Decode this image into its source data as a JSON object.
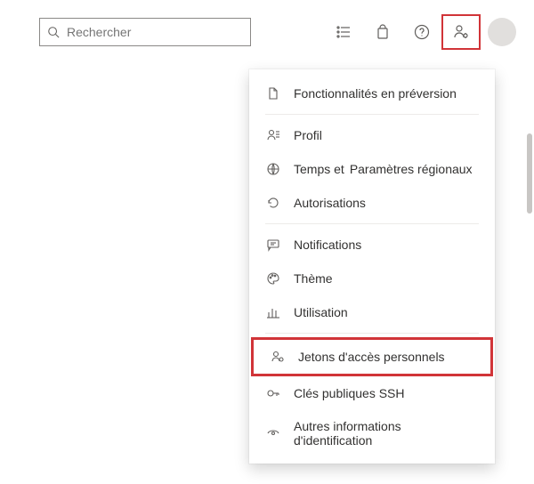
{
  "search": {
    "placeholder": "Rechercher"
  },
  "menu": {
    "preview": "Fonctionnalités en préversion",
    "profile": "Profil",
    "timeand": "Temps et",
    "regional": "Paramètres régionaux",
    "permissions": "Autorisations",
    "notifications": "Notifications",
    "theme": "Thème",
    "usage": "Utilisation",
    "pat": "Jetons d'accès personnels",
    "ssh": "Clés publiques SSH",
    "othercreds": "Autres informations d'identification"
  }
}
